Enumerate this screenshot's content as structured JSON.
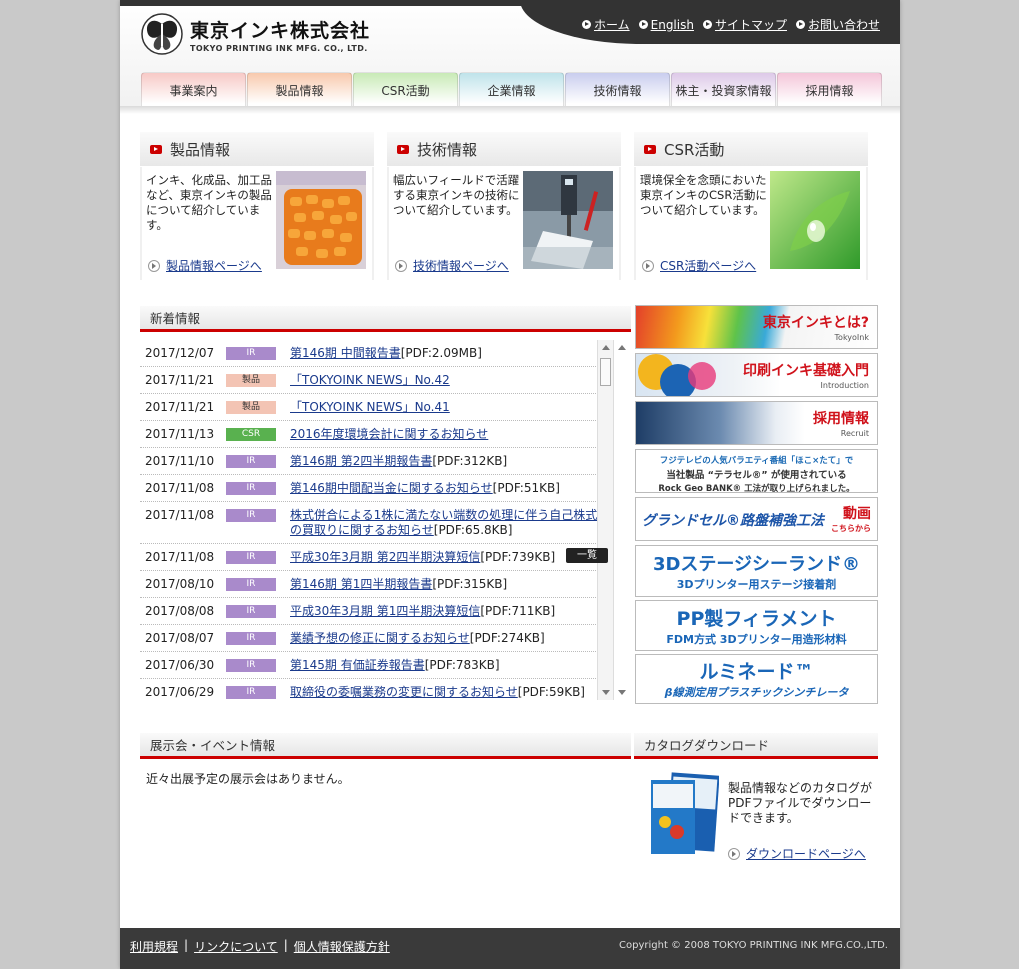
{
  "header": {
    "logo_jp": "東京インキ株式会社",
    "logo_en": "TOKYO PRINTING INK MFG. CO., LTD.",
    "top_links": [
      "ホーム",
      "English",
      "サイトマップ",
      "お問い合わせ"
    ]
  },
  "global_nav": [
    {
      "label": "事業案内",
      "color": "#f7c9c6"
    },
    {
      "label": "製品情報",
      "color": "#f8c9ad"
    },
    {
      "label": "CSR活動",
      "color": "#c8eab6"
    },
    {
      "label": "企業情報",
      "color": "#bfe3ea"
    },
    {
      "label": "技術情報",
      "color": "#c9cdee"
    },
    {
      "label": "株主・投資家情報",
      "color": "#ddc9e8"
    },
    {
      "label": "採用情報",
      "color": "#f4c6d9"
    }
  ],
  "feature_boxes": [
    {
      "title": "製品情報",
      "text": "インキ、化成品、加工品など、東京インキの製品について紹介しています。",
      "link": "製品情報ページへ"
    },
    {
      "title": "技術情報",
      "text": "幅広いフィールドで活躍する東京インキの技術について紹介しています。",
      "link": "技術情報ページへ"
    },
    {
      "title": "CSR活動",
      "text": "環境保全を念頭においた東京インキのCSR活動について紹介しています。",
      "link": "CSR活動ページへ"
    }
  ],
  "news": {
    "heading": "新着情報",
    "list_button": "一覧",
    "items": [
      {
        "date": "2017/12/07",
        "category": "IR",
        "type": "ir",
        "title": "第146期 中間報告書",
        "suffix": "[PDF:2.09MB]"
      },
      {
        "date": "2017/11/21",
        "category": "製品",
        "type": "product",
        "title": "「TOKYOINK NEWS」No.42",
        "suffix": ""
      },
      {
        "date": "2017/11/21",
        "category": "製品",
        "type": "product",
        "title": "「TOKYOINK NEWS」No.41",
        "suffix": ""
      },
      {
        "date": "2017/11/13",
        "category": "CSR",
        "type": "csr",
        "title": "2016年度環境会計に関するお知らせ",
        "suffix": ""
      },
      {
        "date": "2017/11/10",
        "category": "IR",
        "type": "ir",
        "title": "第146期 第2四半期報告書",
        "suffix": "[PDF:312KB]"
      },
      {
        "date": "2017/11/08",
        "category": "IR",
        "type": "ir",
        "title": "第146期中間配当金に関するお知らせ",
        "suffix": "[PDF:51KB]"
      },
      {
        "date": "2017/11/08",
        "category": "IR",
        "type": "ir",
        "title": "株式併合による1株に満たない端数の処理に伴う自己株式の買取りに関するお知らせ",
        "suffix": "[PDF:65.8KB]"
      },
      {
        "date": "2017/11/08",
        "category": "IR",
        "type": "ir",
        "title": "平成30年3月期 第2四半期決算短信",
        "suffix": "[PDF:739KB]"
      },
      {
        "date": "2017/08/10",
        "category": "IR",
        "type": "ir",
        "title": "第146期 第1四半期報告書",
        "suffix": "[PDF:315KB]"
      },
      {
        "date": "2017/08/08",
        "category": "IR",
        "type": "ir",
        "title": "平成30年3月期 第1四半期決算短信",
        "suffix": "[PDF:711KB]"
      },
      {
        "date": "2017/08/07",
        "category": "IR",
        "type": "ir",
        "title": "業績予想の修正に関するお知らせ",
        "suffix": "[PDF:274KB]"
      },
      {
        "date": "2017/06/30",
        "category": "IR",
        "type": "ir",
        "title": "第145期 有価証券報告書",
        "suffix": "[PDF:783KB]"
      },
      {
        "date": "2017/06/29",
        "category": "IR",
        "type": "ir",
        "title": "取締役の委嘱業務の変更に関するお知らせ",
        "suffix": "[PDF:59KB]"
      }
    ]
  },
  "banners": [
    {
      "main": "東京インキとは?",
      "sub": "TokyoInk"
    },
    {
      "main": "印刷インキ基礎入門",
      "sub": "Introduction"
    },
    {
      "main": "採用情報",
      "sub": "Recruit"
    },
    {
      "line1": "フジテレビの人気バラエティ番組「ほこ×たて」で",
      "line2": "当社製品 “テラセル®” が使用されている",
      "line3": "Rock Geo BANK® 工法が取り上げられました。"
    },
    {
      "main": "グランドセル®路盤補強工法",
      "sub": "動画",
      "sub2": "こちらから"
    },
    {
      "main": "3Dステージシーランド®",
      "sub": "3Dプリンター用ステージ接着剤"
    },
    {
      "main": "PP製フィラメント",
      "sub": "FDM方式 3Dプリンター用造形材料"
    },
    {
      "main": "ルミネード™",
      "sub": "β線測定用プラスチックシンチレータ"
    }
  ],
  "events": {
    "heading": "展示会・イベント情報",
    "text": "近々出展予定の展示会はありません。"
  },
  "catalog": {
    "heading": "カタログダウンロード",
    "text": "製品情報などのカタログがPDFファイルでダウンロードできます。",
    "link": "ダウンロードページへ"
  },
  "footer": {
    "links": [
      "利用規程",
      "リンクについて",
      "個人情報保護方針"
    ],
    "copyright": "Copyright © 2008 TOKYO PRINTING INK MFG.CO.,LTD."
  }
}
